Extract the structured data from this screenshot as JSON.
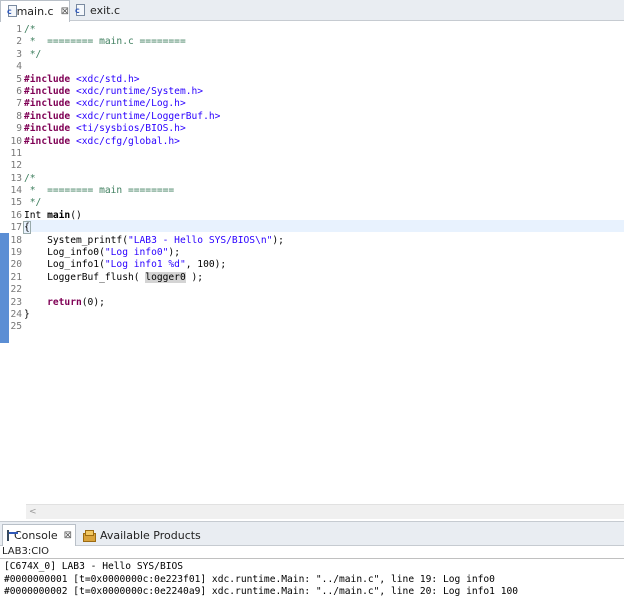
{
  "editor_tabs": [
    {
      "label": "main.c",
      "close": "⊠",
      "active": true
    },
    {
      "label": "exit.c",
      "active": false
    }
  ],
  "code_lines": [
    {
      "n": "1",
      "parts": [
        {
          "t": "/*",
          "c": "cm"
        }
      ]
    },
    {
      "n": "2",
      "parts": [
        {
          "t": " *  ======== main.c ========",
          "c": "cm"
        }
      ]
    },
    {
      "n": "3",
      "parts": [
        {
          "t": " */",
          "c": "cm"
        }
      ]
    },
    {
      "n": "4",
      "parts": []
    },
    {
      "n": "5",
      "parts": [
        {
          "t": "#include",
          "c": "kw"
        },
        {
          "t": " <xdc/std.h>",
          "c": "str"
        }
      ]
    },
    {
      "n": "6",
      "parts": [
        {
          "t": "#include",
          "c": "kw"
        },
        {
          "t": " <xdc/runtime/System.h>",
          "c": "str"
        }
      ]
    },
    {
      "n": "7",
      "parts": [
        {
          "t": "#include",
          "c": "kw"
        },
        {
          "t": " <xdc/runtime/Log.h>",
          "c": "str"
        }
      ]
    },
    {
      "n": "8",
      "parts": [
        {
          "t": "#include",
          "c": "kw"
        },
        {
          "t": " <xdc/runtime/LoggerBuf.h>",
          "c": "str"
        }
      ]
    },
    {
      "n": "9",
      "parts": [
        {
          "t": "#include",
          "c": "kw"
        },
        {
          "t": " <ti/sysbios/BIOS.h>",
          "c": "str"
        }
      ]
    },
    {
      "n": "10",
      "parts": [
        {
          "t": "#include",
          "c": "kw"
        },
        {
          "t": " <xdc/cfg/global.h>",
          "c": "str"
        }
      ]
    },
    {
      "n": "11",
      "parts": []
    },
    {
      "n": "12",
      "parts": []
    },
    {
      "n": "13",
      "parts": [
        {
          "t": "/*",
          "c": "cm"
        }
      ]
    },
    {
      "n": "14",
      "parts": [
        {
          "t": " *  ======== main ========",
          "c": "cm"
        }
      ]
    },
    {
      "n": "15",
      "parts": [
        {
          "t": " */",
          "c": "cm"
        }
      ]
    },
    {
      "n": "16",
      "parts": [
        {
          "t": "Int ",
          "c": "dflt"
        },
        {
          "t": "main",
          "c": "bold"
        },
        {
          "t": "()",
          "c": "dflt"
        }
      ]
    },
    {
      "n": "17",
      "parts": [
        {
          "t": "{",
          "c": "caret-brace"
        }
      ]
    },
    {
      "n": "18",
      "parts": [
        {
          "t": "    System_printf(",
          "c": "dflt"
        },
        {
          "t": "\"LAB3 - Hello SYS/BIOS\\n\"",
          "c": "str"
        },
        {
          "t": ");",
          "c": "dflt"
        }
      ]
    },
    {
      "n": "19",
      "parts": [
        {
          "t": "    Log_info0(",
          "c": "dflt"
        },
        {
          "t": "\"Log info0\"",
          "c": "str"
        },
        {
          "t": ");",
          "c": "dflt"
        }
      ]
    },
    {
      "n": "20",
      "parts": [
        {
          "t": "    Log_info1(",
          "c": "dflt"
        },
        {
          "t": "\"Log info1 %d\"",
          "c": "str"
        },
        {
          "t": ", 100);",
          "c": "dflt"
        }
      ]
    },
    {
      "n": "21",
      "parts": [
        {
          "t": "    LoggerBuf_flush( ",
          "c": "dflt"
        },
        {
          "t": "logger0",
          "c": "highlight"
        },
        {
          "t": " );",
          "c": "dflt"
        }
      ]
    },
    {
      "n": "22",
      "parts": []
    },
    {
      "n": "23",
      "parts": [
        {
          "t": "    ",
          "c": "dflt"
        },
        {
          "t": "return",
          "c": "kw"
        },
        {
          "t": "(0);",
          "c": "dflt"
        }
      ]
    },
    {
      "n": "24",
      "parts": [
        {
          "t": "}",
          "c": "dflt"
        }
      ]
    },
    {
      "n": "25",
      "parts": []
    }
  ],
  "hscroll_arrow": "<",
  "console_tabs": [
    {
      "label": "Console",
      "close": "⊠",
      "active": true
    },
    {
      "label": "Available Products",
      "active": false
    }
  ],
  "console_title": "LAB3:CIO",
  "console_lines": [
    "[C674X_0] LAB3 - Hello SYS/BIOS",
    "#0000000001 [t=0x0000000c:0e223f01] xdc.runtime.Main: \"../main.c\", line 19: Log info0",
    "#0000000002 [t=0x0000000c:0e2240a9] xdc.runtime.Main: \"../main.c\", line 20: Log info1 100"
  ]
}
